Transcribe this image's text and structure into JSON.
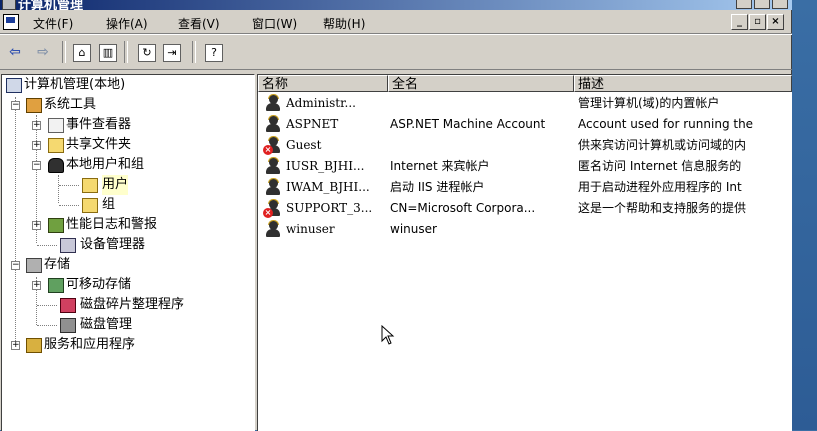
{
  "window": {
    "title": "计算机管理"
  },
  "menu": {
    "items": [
      "文件(F)",
      "操作(A)",
      "查看(V)",
      "窗口(W)",
      "帮助(H)"
    ],
    "mdi_buttons": [
      "_",
      "▫",
      "×"
    ]
  },
  "toolbar": {
    "buttons": [
      "back-arrow",
      "forward-arrow",
      "up-folder",
      "show-hide-tree",
      "refresh",
      "export-list",
      "help"
    ]
  },
  "tree": {
    "root": "计算机管理(本地)",
    "system_tools": "系统工具",
    "event_viewer": "事件查看器",
    "shared_folders": "共享文件夹",
    "local_users_groups": "本地用户和组",
    "users": "用户",
    "groups": "组",
    "perf_logs": "性能日志和警报",
    "device_manager": "设备管理器",
    "storage": "存储",
    "removable_storage": "可移动存储",
    "defrag": "磁盘碎片整理程序",
    "disk_management": "磁盘管理",
    "services_apps": "服务和应用程序"
  },
  "list": {
    "columns": {
      "name": "名称",
      "fullname": "全名",
      "description": "描述"
    },
    "rows": [
      {
        "name": "Administr...",
        "fullname": "",
        "description": "管理计算机(域)的内置帐户",
        "disabled": false
      },
      {
        "name": "ASPNET",
        "fullname": "ASP.NET Machine Account",
        "description": "Account used for running the",
        "disabled": false
      },
      {
        "name": "Guest",
        "fullname": "",
        "description": "供来宾访问计算机或访问域的内",
        "disabled": true
      },
      {
        "name": "IUSR_BJHI...",
        "fullname": "Internet 来宾帐户",
        "description": "匿名访问 Internet 信息服务的",
        "disabled": false
      },
      {
        "name": "IWAM_BJHI...",
        "fullname": "启动 IIS 进程帐户",
        "description": "用于启动进程外应用程序的 Int",
        "disabled": false
      },
      {
        "name": "SUPPORT_3...",
        "fullname": "CN=Microsoft Corpora...",
        "description": "这是一个帮助和支持服务的提供",
        "disabled": true
      },
      {
        "name": "winuser",
        "fullname": "winuser",
        "description": "",
        "disabled": false
      }
    ]
  },
  "colors": {
    "titlebar": "#0a246a",
    "face": "#d4d0c8",
    "desktop": "#3a6ea5",
    "disabled_badge": "#e02020"
  }
}
